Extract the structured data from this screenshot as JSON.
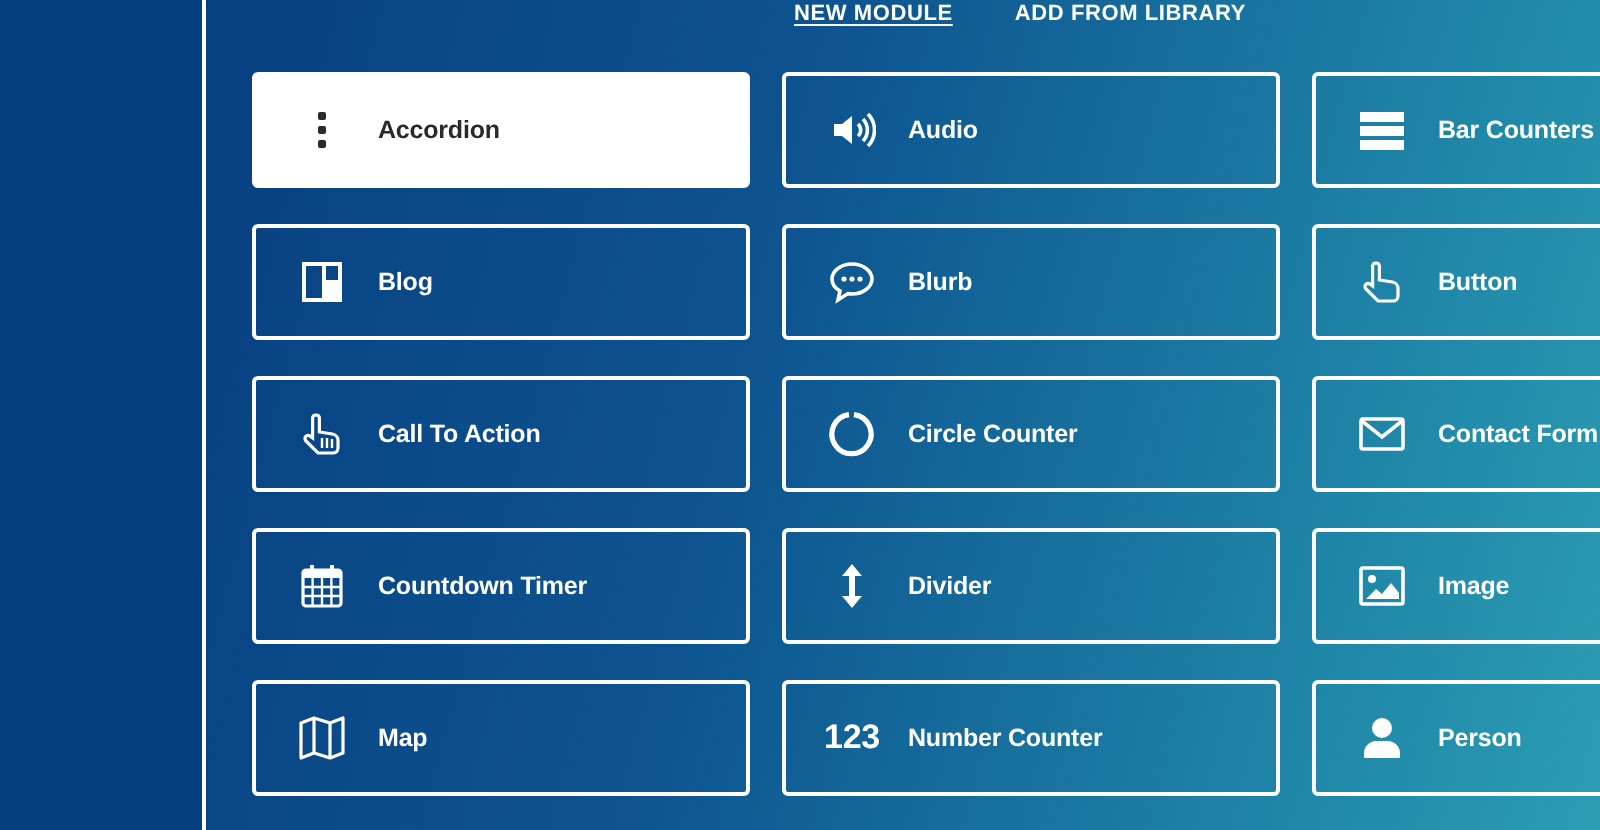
{
  "tabs": [
    {
      "label": "NEW MODULE",
      "selected": true
    },
    {
      "label": "ADD FROM LIBRARY",
      "selected": false
    }
  ],
  "modules": [
    {
      "label": "Accordion",
      "kind": "accordion",
      "selected": true
    },
    {
      "label": "Audio",
      "kind": "audio",
      "selected": false
    },
    {
      "label": "Bar Counters",
      "kind": "bars",
      "selected": false
    },
    {
      "label": "Blog",
      "kind": "blog",
      "selected": false
    },
    {
      "label": "Blurb",
      "kind": "blurb",
      "selected": false
    },
    {
      "label": "Button",
      "kind": "button",
      "selected": false
    },
    {
      "label": "Call To Action",
      "kind": "cta",
      "selected": false
    },
    {
      "label": "Circle Counter",
      "kind": "circle",
      "selected": false
    },
    {
      "label": "Contact Form",
      "kind": "mail",
      "selected": false
    },
    {
      "label": "Countdown Timer",
      "kind": "calendar",
      "selected": false
    },
    {
      "label": "Divider",
      "kind": "divider",
      "selected": false
    },
    {
      "label": "Image",
      "kind": "image",
      "selected": false
    },
    {
      "label": "Map",
      "kind": "map",
      "selected": false
    },
    {
      "label": "Number Counter",
      "kind": "number",
      "icon_text": "123",
      "selected": false
    },
    {
      "label": "Person",
      "kind": "person",
      "selected": false
    }
  ]
}
